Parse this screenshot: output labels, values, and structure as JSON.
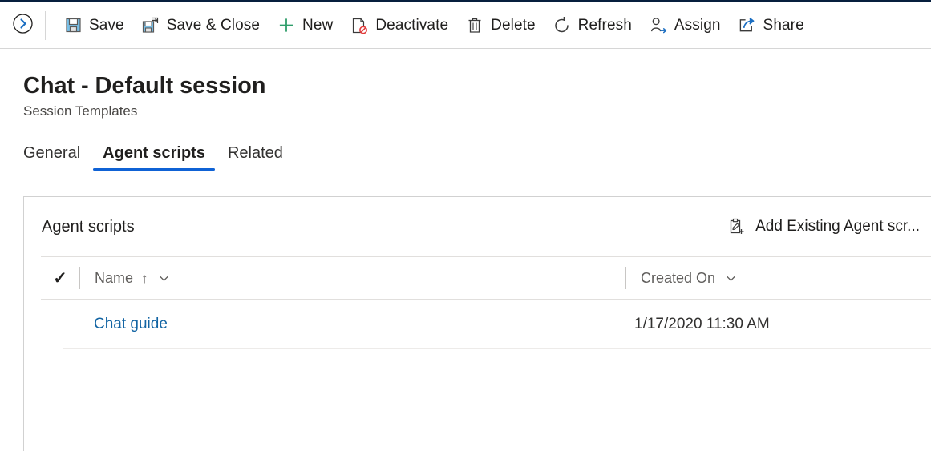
{
  "window": {
    "accent_strip_color": "#071f3d",
    "link_color": "#1264a3",
    "tab_underline_color": "#0f62d5"
  },
  "command_bar": {
    "expand_button": {
      "name": "expand-panel-button",
      "icon": "chevron-right-circle-icon"
    },
    "items": [
      {
        "label": "Save",
        "icon": "save-floppy-icon"
      },
      {
        "label": "Save & Close",
        "icon": "save-and-close-icon"
      },
      {
        "label": "New",
        "icon": "plus-icon"
      },
      {
        "label": "Deactivate",
        "icon": "deactivate-document-icon"
      },
      {
        "label": "Delete",
        "icon": "trash-icon"
      },
      {
        "label": "Refresh",
        "icon": "refresh-icon"
      },
      {
        "label": "Assign",
        "icon": "assign-person-icon"
      },
      {
        "label": "Share",
        "icon": "share-icon"
      }
    ]
  },
  "header": {
    "title": "Chat - Default session",
    "subtitle": "Session Templates"
  },
  "tabs": [
    {
      "label": "General",
      "active": false
    },
    {
      "label": "Agent scripts",
      "active": true
    },
    {
      "label": "Related",
      "active": false
    }
  ],
  "subgrid": {
    "title": "Agent scripts",
    "action": {
      "label": "Add Existing Agent scr...",
      "icon": "add-existing-record-icon"
    },
    "grid": {
      "select_all_icon": "checkmark-icon",
      "columns": [
        {
          "label": "Name",
          "sort": "ascending",
          "sort_glyph": "↑",
          "menu_icon": "chevron-down-icon"
        },
        {
          "label": "Created On",
          "sort": "none",
          "sort_glyph": "",
          "menu_icon": "chevron-down-icon"
        }
      ],
      "rows": [
        {
          "name": "Chat guide",
          "created_on": "1/17/2020 11:30 AM"
        }
      ]
    }
  }
}
